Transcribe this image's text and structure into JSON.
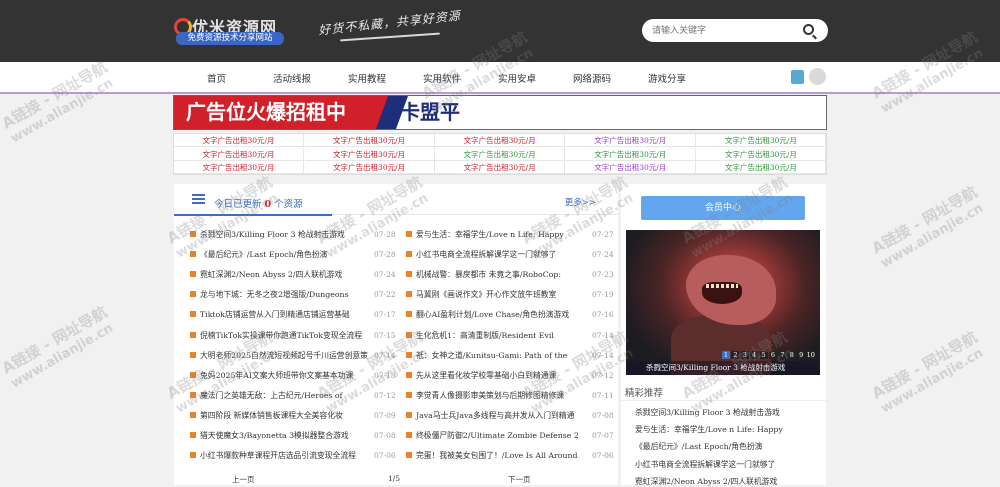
{
  "header": {
    "logo_main": "优米资源网",
    "logo_sub": "免费资源技术分享网站",
    "slogan": "好货不私藏，共享好资源",
    "search_placeholder": "请输入关键字"
  },
  "nav": {
    "items": [
      "首页",
      "活动线报",
      "实用教程",
      "实用软件",
      "实用安卓",
      "网络源码",
      "游戏分享"
    ]
  },
  "banner": {
    "text_red": "广告位火爆招租中",
    "text_blue": "卡盟平"
  },
  "ads": {
    "label": "文字广告出租30元/月",
    "colors": [
      "#d0202a",
      "#d0202a",
      "#d0202a",
      "#9a3fd0",
      "#2a9a3a",
      "#d0202a",
      "#d0202a",
      "#2a9a3a",
      "#2a9a3a",
      "#2a9a3a",
      "#d0202a",
      "#d0202a",
      "#d0202a",
      "#9a3fd0",
      "#2a9a3a"
    ]
  },
  "main": {
    "today_prefix": "今日已更新",
    "today_count": "0",
    "today_suffix": "个资源",
    "more": "更多>>",
    "left_items": [
      {
        "title": "杀戮空间3/Killing Floor 3 枪战射击游戏",
        "date": "07-28"
      },
      {
        "title": "《最后纪元》/Last Epoch/角色扮演",
        "date": "07-28"
      },
      {
        "title": "霓虹深渊2/Neon Abyss 2/四人联机游戏",
        "date": "07-24"
      },
      {
        "title": "龙与地下城：无冬之夜2增强版/Dungeons",
        "date": "07-22"
      },
      {
        "title": "Tiktok店铺运营从入门到精通店铺运营基础",
        "date": "07-17"
      },
      {
        "title": "倪楠TikTok实操课带你跑通TikTok变现全流程",
        "date": "07-15"
      },
      {
        "title": "大明老师2025自然流短视频起号千川运营创意策划",
        "date": "07-14"
      },
      {
        "title": "兔妈2025年AI文案大师班带你文案基本功课",
        "date": "07-13"
      },
      {
        "title": "魔法门之英雄无敌：上古纪元/Heroes of",
        "date": "07-12"
      },
      {
        "title": "第四阶段 新媒体销售板课程大全美容化妆",
        "date": "07-09"
      },
      {
        "title": "猎天使魔女3/Bayonetta 3模拟器整合游戏",
        "date": "07-08"
      },
      {
        "title": "小红书爆款种草课程开店选品引流变现全流程",
        "date": "07-06"
      }
    ],
    "right_items": [
      {
        "title": "爱与生活：幸福学生/Love n Life: Happy",
        "date": "07-27"
      },
      {
        "title": "小红书电商全流程拆解课学这一门就够了",
        "date": "07-24"
      },
      {
        "title": "机械战警：暴戾都市 未竟之事/RoboCop:",
        "date": "07-23"
      },
      {
        "title": "马冀刚《画说作文》开心作文放牛班教室",
        "date": "07-19"
      },
      {
        "title": "翻心AI盈利计划/Love Chase/角色扮演游戏",
        "date": "07-16"
      },
      {
        "title": "生化危机1：高清重制版/Resident Evil",
        "date": "07-14"
      },
      {
        "title": "祇：女神之道/Kunitsu-Gami: Path of the",
        "date": "07-14"
      },
      {
        "title": "先从这里看化妆学校零基础小白到精通课",
        "date": "07-12"
      },
      {
        "title": "李觉青人像摄影审美策划与后期修图精修课",
        "date": "07-11"
      },
      {
        "title": "Java马士兵Java多线程与高并发从入门到精通",
        "date": "07-08"
      },
      {
        "title": "终极僵尸防御2/Ultimate Zombie Defense 2",
        "date": "07-07"
      },
      {
        "title": "完蛋！我被美女包围了！/Love Is All Around",
        "date": "07-06"
      }
    ],
    "pager_prev": "上一页",
    "pager_page": "1/5",
    "pager_next": "下一页"
  },
  "side": {
    "member_btn": "会员中心",
    "img_caption": "杀戮空间3/Killing Floor 3 枪战射击游戏",
    "dots": [
      "1",
      "2",
      "3",
      "4",
      "5",
      "6",
      "7",
      "8",
      "9",
      "10"
    ],
    "active_dot": "1",
    "rec_title": "精彩推荐",
    "rec_items": [
      "杀戮空间3/Killing Floor 3 枪战射击游戏",
      "爱与生活：幸福学生/Love n Life: Happy",
      "《最后纪元》/Last Epoch/角色扮演",
      "小红书电商全流程拆解课学这一门就够了",
      "霓虹深渊2/Neon Abyss 2/四人联机游戏"
    ]
  },
  "watermark": {
    "line1": "A链接 - 网址导航",
    "line2": "www.alianjie.cn"
  }
}
